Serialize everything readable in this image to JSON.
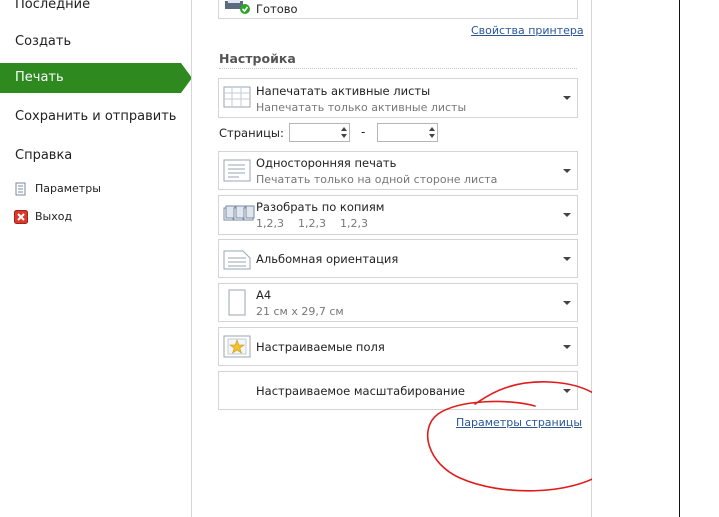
{
  "nav": {
    "items": [
      {
        "label": "Последние"
      },
      {
        "label": "Создать"
      },
      {
        "label": "Печать"
      },
      {
        "label": "Сохранить и отправить"
      },
      {
        "label": "Справка"
      }
    ],
    "small": [
      {
        "label": "Параметры",
        "icon": "options-icon"
      },
      {
        "label": "Выход",
        "icon": "exit-icon"
      }
    ],
    "active_color": "#2e8a1f"
  },
  "printer": {
    "status": "Готово",
    "properties_link": "Свойства принтера"
  },
  "settings": {
    "title": "Настройка",
    "pages_label": "Страницы:",
    "pages_dash": "-",
    "from_value": "",
    "to_value": "",
    "dropdowns": [
      {
        "line1": "Напечатать активные листы",
        "line2": "Напечатать только активные листы"
      },
      {
        "line1": "Односторонняя печать",
        "line2": "Печатать только на одной стороне листа"
      },
      {
        "line1": "Разобрать по копиям",
        "line2": "1,2,3    1,2,3    1,2,3"
      },
      {
        "line1": "Альбомная ориентация",
        "line2": ""
      },
      {
        "line1": "A4",
        "line2": "21 см x 29,7 см"
      },
      {
        "line1": "Настраиваемые поля",
        "line2": ""
      },
      {
        "line1": "Настраиваемое масштабирование",
        "line2": ""
      }
    ],
    "page_setup_link": "Параметры страницы"
  },
  "annotation_color": "#e21a1a"
}
